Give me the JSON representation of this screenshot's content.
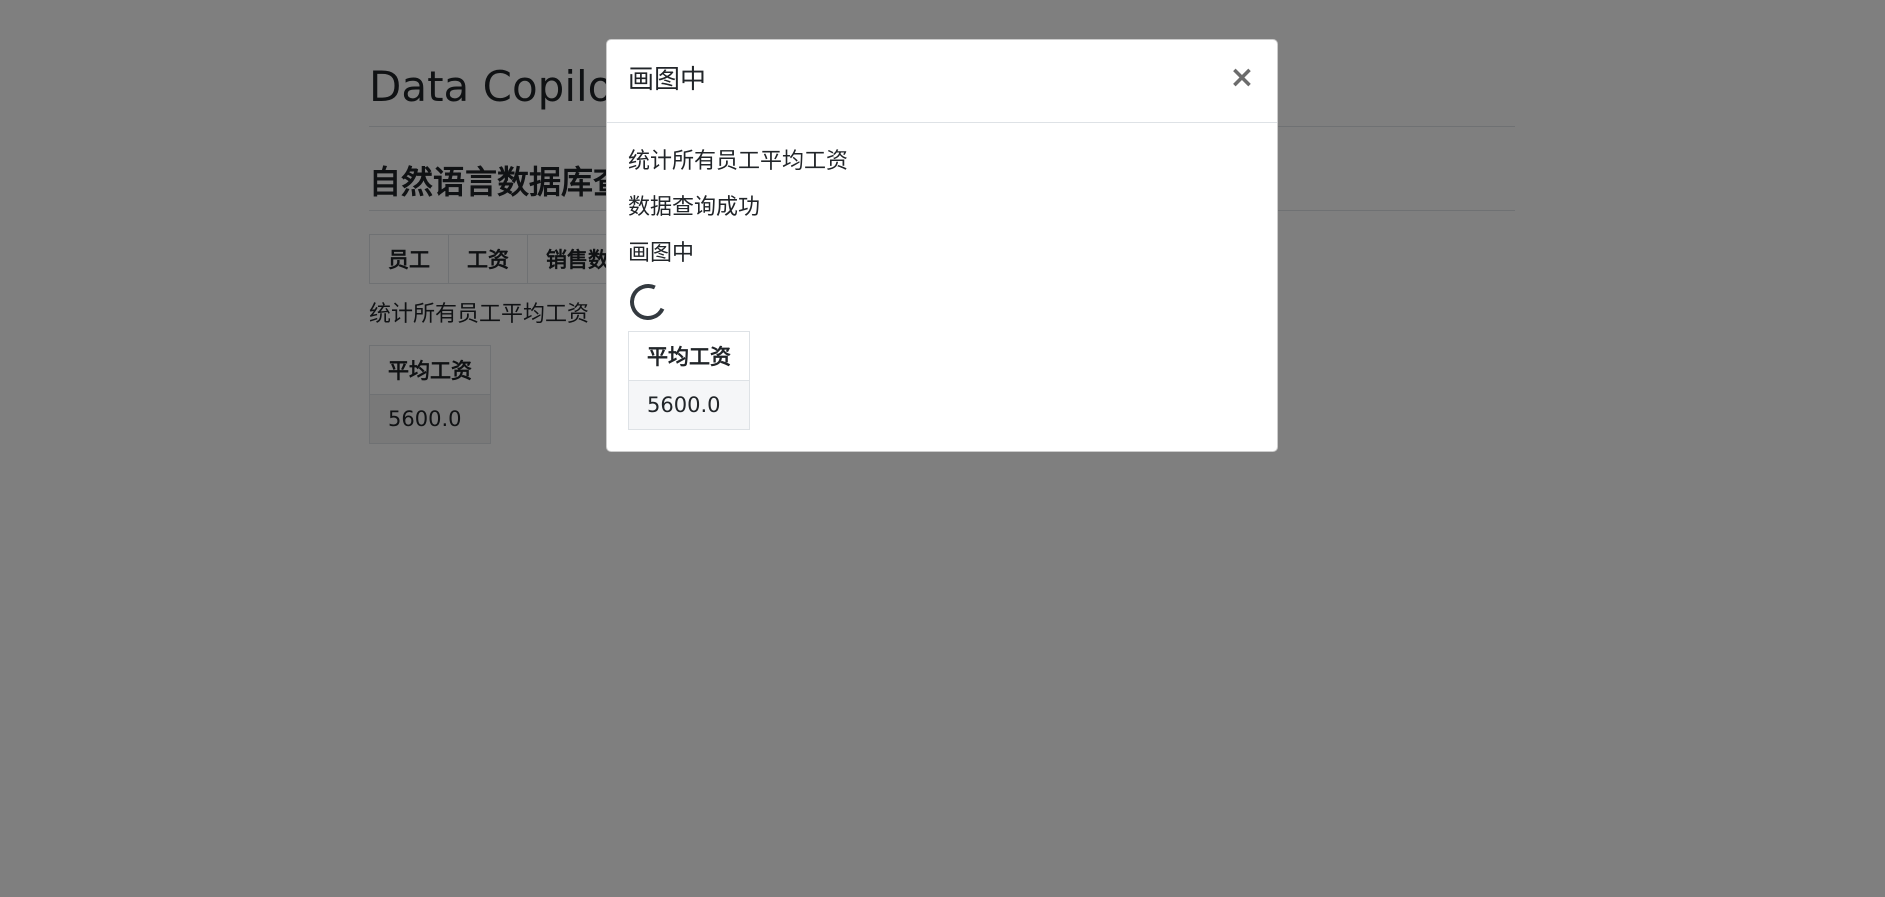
{
  "app": {
    "title": "Data Copilot",
    "section_title": "自然语言数据库查询"
  },
  "background_table": {
    "headers": [
      "员工",
      "工资",
      "销售数"
    ]
  },
  "background_query": {
    "text": "统计所有员工平均工资"
  },
  "background_result": {
    "header": "平均工资",
    "value": "5600.0"
  },
  "modal": {
    "title": "画图中",
    "close_label": "×",
    "lines": [
      "统计所有员工平均工资",
      "数据查询成功",
      "画图中"
    ],
    "result": {
      "header": "平均工资",
      "value": "5600.0"
    }
  },
  "colors": {
    "backdrop": "rgba(0,0,0,0.5)",
    "text": "#212529",
    "spinner": "#343a40"
  }
}
